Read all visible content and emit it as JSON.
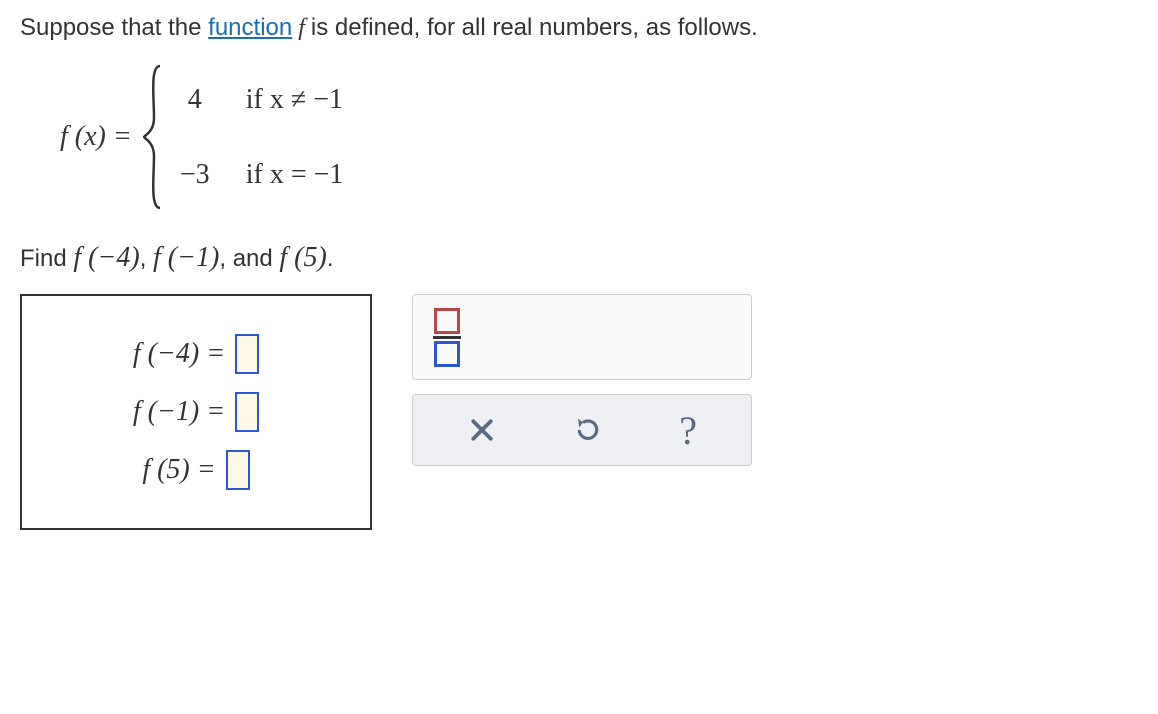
{
  "intro": {
    "prefix": "Suppose that the ",
    "link": "function",
    "f": " f ",
    "suffix": "is defined, for all real numbers, as follows."
  },
  "definition": {
    "lhs": "f (x) =",
    "piece1": {
      "value": "4",
      "cond": "if x ≠ −1"
    },
    "piece2": {
      "value": "−3",
      "cond": "if x = −1"
    }
  },
  "findline": {
    "prefix": "Find ",
    "a": "f (−4)",
    "sep1": ", ",
    "b": "f (−1)",
    "sep2": ", and ",
    "c": "f (5)",
    "dot": "."
  },
  "answers": {
    "row1_label": "f (−4) =",
    "row2_label": "f (−1) =",
    "row3_label": "f (5) ="
  },
  "icons": {
    "fraction": "fraction-icon",
    "clear": "x-icon",
    "undo": "undo-icon",
    "help": "?"
  }
}
